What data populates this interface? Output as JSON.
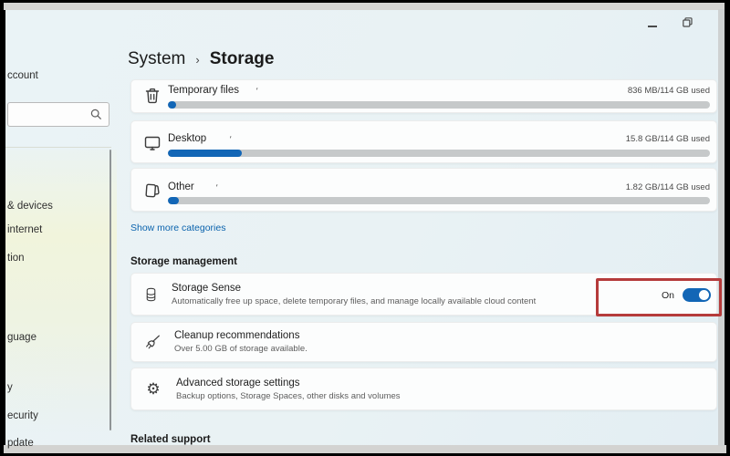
{
  "window": {
    "controls": {
      "minimize": "minimize",
      "restore": "restore"
    }
  },
  "sidebar": {
    "account_fragment": "ccount",
    "search": {
      "placeholder": ""
    },
    "items": [
      {
        "label": "& devices"
      },
      {
        "label": "internet"
      },
      {
        "label": "tion"
      },
      {
        "label": "guage"
      },
      {
        "label": "y"
      },
      {
        "label": "ecurity"
      },
      {
        "label": "pdate"
      }
    ]
  },
  "breadcrumb": {
    "parent": "System",
    "separator": "›",
    "current": "Storage"
  },
  "categories": [
    {
      "name": "Temporary files",
      "mark": "'",
      "usage": "836 MB/114 GB used",
      "percent": 1.5,
      "icon": "trash-icon"
    },
    {
      "name": "Desktop",
      "mark": "'",
      "usage": "15.8 GB/114 GB used",
      "percent": 13.7,
      "icon": "monitor-icon"
    },
    {
      "name": "Other",
      "mark": "'",
      "usage": "1.82 GB/114 GB used",
      "percent": 2.0,
      "icon": "document-icon"
    }
  ],
  "links": {
    "show_more": "Show more categories"
  },
  "sections": {
    "storage_management": "Storage management",
    "related_support": "Related support"
  },
  "cards": {
    "storage_sense": {
      "title": "Storage Sense",
      "subtitle": "Automatically free up space, delete temporary files, and manage locally available cloud content",
      "toggle_label": "On",
      "toggle_state": "on"
    },
    "cleanup": {
      "title": "Cleanup recommendations",
      "subtitle": "Over 5.00 GB of storage available."
    },
    "advanced": {
      "title": "Advanced storage settings",
      "subtitle": "Backup options, Storage Spaces, other disks and volumes"
    }
  },
  "colors": {
    "accent": "#1266b6",
    "link": "#0a62ad",
    "highlight_red": "#b53b3b",
    "bar_track": "#c6c9ca"
  }
}
